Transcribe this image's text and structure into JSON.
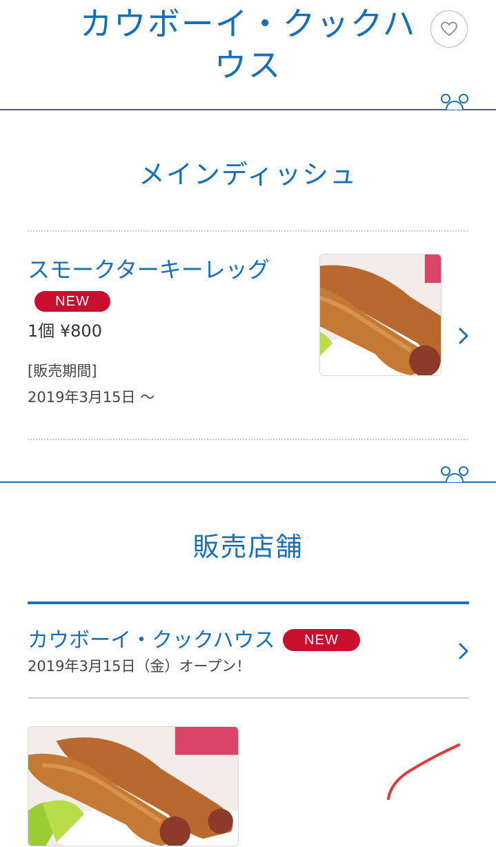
{
  "header": {
    "title_line1": "カウボーイ・クックハ",
    "title_line2": "ウス",
    "favorite_icon": "heart-outline-icon"
  },
  "main_dish": {
    "heading": "メインディッシュ",
    "item": {
      "name": "スモークターキーレッグ",
      "badge": "NEW",
      "price": "1個 ¥800",
      "period_label": "[販売期間]",
      "period_value": "2019年3月15日 〜",
      "image_alt": "スモークターキーレッグ"
    }
  },
  "stores": {
    "heading": "販売店舗",
    "store": {
      "name": "カウボーイ・クックハウス",
      "badge": "NEW",
      "note": "2019年3月15日（金）オープン！",
      "image_alt": "カウボーイ・クックハウス"
    }
  },
  "colors": {
    "accent": "#1470b8",
    "badge": "#c8102e",
    "annotation": "#e03a3a"
  }
}
